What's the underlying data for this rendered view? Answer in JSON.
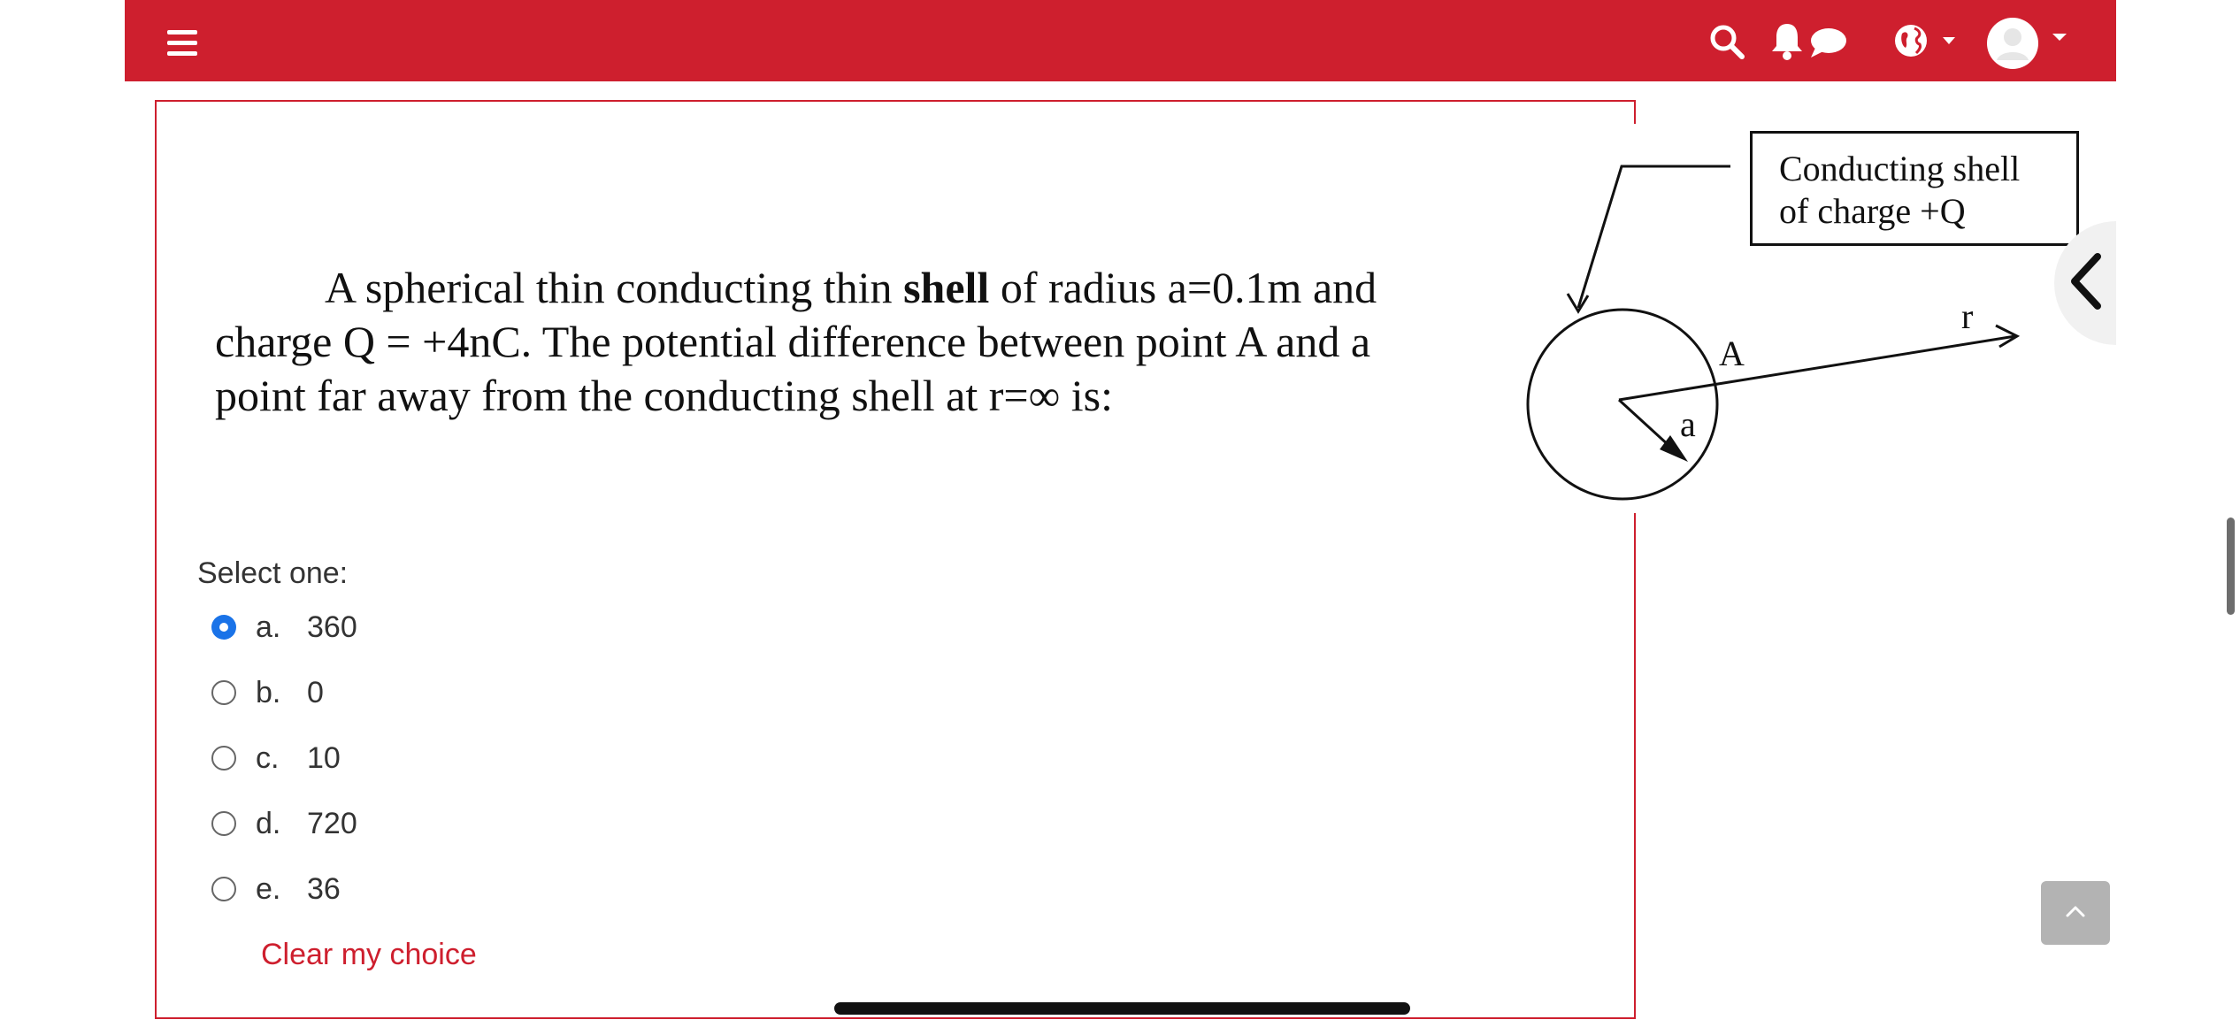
{
  "colors": {
    "brand": "#ce1f2e",
    "radio_checked": "#1a73e8",
    "back_to_top": "#b3b3b3"
  },
  "navbar": {
    "menu_icon": "hamburger-menu-icon",
    "icons": [
      "search-icon",
      "bell-icon",
      "chat-icon",
      "globe-language-icon",
      "avatar-icon"
    ]
  },
  "question": {
    "text_part1": "A spherical thin conducting thin ",
    "text_bold": "shell",
    "text_part2": " of radius a=0.1m and charge Q = +4nC. The potential difference between point A and a point far away from the conducting shell at r=∞ is:",
    "select_prompt": "Select one:",
    "options": [
      {
        "letter": "a.",
        "value": "360",
        "selected": true
      },
      {
        "letter": "b.",
        "value": "0",
        "selected": false
      },
      {
        "letter": "c.",
        "value": "10",
        "selected": false
      },
      {
        "letter": "d.",
        "value": "720",
        "selected": false
      },
      {
        "letter": "e.",
        "value": "36",
        "selected": false
      }
    ],
    "clear_label": "Clear my choice"
  },
  "diagram": {
    "label_line1": "Conducting shell",
    "label_line2": "of charge +Q",
    "point_label": "A",
    "radius_label": "a",
    "r_label": "r"
  }
}
